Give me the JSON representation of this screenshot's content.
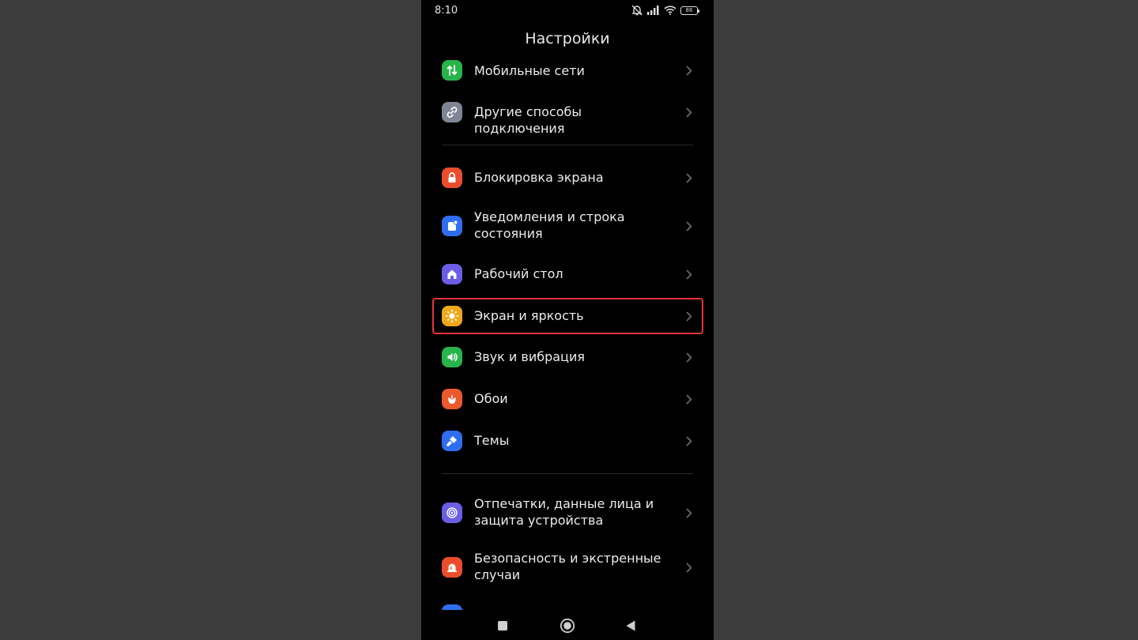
{
  "status_bar": {
    "time": "8:10",
    "battery_level": "86"
  },
  "header": {
    "title": "Настройки"
  },
  "settings": {
    "mobile_networks": "Мобильные сети",
    "other_connections": "Другие способы подключения",
    "lock_screen": "Блокировка экрана",
    "notifications": "Уведомления и строка состояния",
    "home_screen": "Рабочий стол",
    "display": "Экран и яркость",
    "sound": "Звук и вибрация",
    "wallpaper": "Обои",
    "themes": "Темы",
    "fingerprints": "Отпечатки, данные лица и защита устройства",
    "safety": "Безопасность и экстренные случаи"
  },
  "colors": {
    "background": "#000000",
    "highlight": "#e8343c",
    "mobile_networks": "#27b44a",
    "other_connections": "#7f8593",
    "lock_screen": "#ea4d2b",
    "notifications": "#2f6ef0",
    "home_screen": "#6a5ee6",
    "display": "#f0a81b",
    "sound": "#27b44a",
    "wallpaper": "#ea5a2c",
    "themes": "#2f6ef0",
    "fingerprints": "#6a5ee6",
    "safety": "#ea4d2b"
  },
  "icons": {
    "mobile_networks": "mobile-data-arrows-icon",
    "other_connections": "link-icon",
    "lock_screen": "lock-icon",
    "notifications": "notification-icon",
    "home_screen": "home-icon",
    "display": "sun-icon",
    "sound": "speaker-icon",
    "wallpaper": "flower-icon",
    "themes": "brush-icon",
    "fingerprints": "fingerprint-icon",
    "safety": "alarm-icon"
  }
}
